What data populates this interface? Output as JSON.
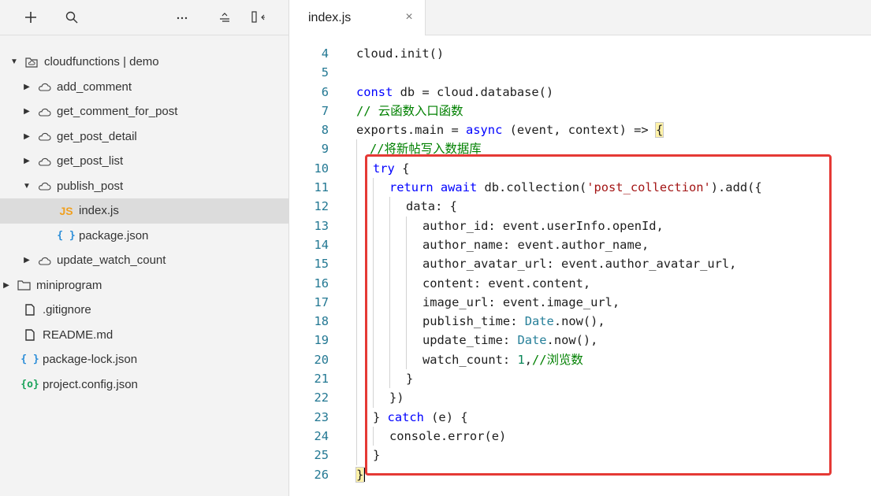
{
  "sidebar": {
    "toolbar_icons": [
      "plus-icon",
      "search-icon",
      "more-icon",
      "collapse-all-icon",
      "split-panel-icon"
    ],
    "project_label": "cloudfunctions | demo",
    "items": [
      {
        "label": "add_comment"
      },
      {
        "label": "get_comment_for_post"
      },
      {
        "label": "get_post_detail"
      },
      {
        "label": "get_post_list"
      },
      {
        "label": "publish_post"
      },
      {
        "label": "index.js",
        "icon_text": "JS"
      },
      {
        "label": "package.json",
        "icon_text": "{ }"
      },
      {
        "label": "update_watch_count"
      },
      {
        "label": "miniprogram"
      },
      {
        "label": ".gitignore"
      },
      {
        "label": "README.md"
      },
      {
        "label": "package-lock.json",
        "icon_text": "{ }"
      },
      {
        "label": "project.config.json",
        "icon_text": "{o}"
      }
    ]
  },
  "editor": {
    "tab": {
      "label": "index.js",
      "close": "×"
    },
    "code": {
      "ln": [
        "4",
        "5",
        "6",
        "7",
        "8",
        "9",
        "10",
        "11",
        "12",
        "13",
        "14",
        "15",
        "16",
        "17",
        "18",
        "19",
        "20",
        "21",
        "22",
        "23",
        "24",
        "25",
        "26"
      ],
      "l4": {
        "a": "cloud.init()"
      },
      "l6": {
        "a": "const",
        "b": " db = cloud.database()"
      },
      "l7": {
        "a": "// 云函数入口函数"
      },
      "l8": {
        "a": "exports.main = ",
        "b": "async",
        "c": " (event, context) => ",
        "d": "{"
      },
      "l9": {
        "a": "//将新帖写入数据库"
      },
      "l10": {
        "a": "try",
        "b": " {"
      },
      "l11": {
        "a": "return",
        "b": " ",
        "c": "await",
        "d": " db.collection(",
        "e": "'post_collection'",
        "f": ").add({"
      },
      "l12": {
        "a": "data: {"
      },
      "l13": {
        "a": "author_id: event.userInfo.openId,"
      },
      "l14": {
        "a": "author_name: event.author_name,"
      },
      "l15": {
        "a": "author_avatar_url: event.author_avatar_url,"
      },
      "l16": {
        "a": "content: event.content,"
      },
      "l17": {
        "a": "image_url: event.image_url,"
      },
      "l18": {
        "a": "publish_time: ",
        "b": "Date",
        "c": ".now(),"
      },
      "l19": {
        "a": "update_time: ",
        "b": "Date",
        "c": ".now(),"
      },
      "l20": {
        "a": "watch_count: ",
        "b": "1",
        "c": ",",
        "d": "//浏览数"
      },
      "l21": {
        "a": "}"
      },
      "l22": {
        "a": "})"
      },
      "l23": {
        "a": "} ",
        "b": "catch",
        "c": " (e) {"
      },
      "l24": {
        "a": "console.error(e)"
      },
      "l25": {
        "a": "}"
      },
      "l26": {
        "a": "}"
      }
    }
  },
  "colors": {
    "keyword": "#0000ff",
    "comment": "#008000",
    "string": "#a31515",
    "number": "#098658",
    "type": "#267f99",
    "line_number": "#237893",
    "highlight_box": "#e53935",
    "sidebar_bg": "#f3f3f3",
    "selected_row": "#dcdcdc"
  }
}
